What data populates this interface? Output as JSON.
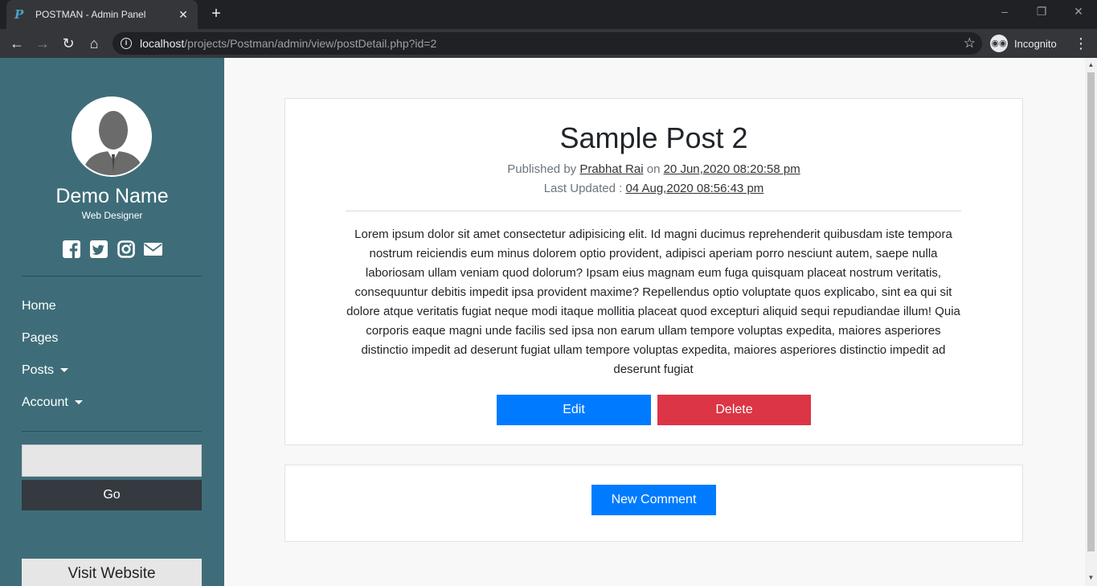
{
  "browser": {
    "tab_title": "POSTMAN - Admin Panel",
    "url_host": "localhost",
    "url_path": "/projects/Postman/admin/view/postDetail.php?id=2",
    "profile_label": "Incognito"
  },
  "sidebar": {
    "name": "Demo Name",
    "role": "Web Designer",
    "social_icons": [
      "facebook-icon",
      "twitter-icon",
      "instagram-icon",
      "envelope-icon"
    ],
    "menu": [
      {
        "label": "Home"
      },
      {
        "label": "Pages"
      },
      {
        "label": "Posts"
      },
      {
        "label": "Account"
      }
    ],
    "search_value": "",
    "go_label": "Go",
    "visit_label": "Visit Website"
  },
  "post": {
    "title": "Sample Post 2",
    "published_prefix": "Published by",
    "author": "Prabhat Rai",
    "on_word": "on",
    "published_date": "20 Jun,2020 08:20:58 pm",
    "updated_prefix": "Last Updated :",
    "updated_date": "04 Aug,2020 08:56:43 pm",
    "body": "Lorem ipsum dolor sit amet consectetur adipisicing elit. Id magni ducimus reprehenderit quibusdam iste tempora nostrum reiciendis eum minus dolorem optio provident, adipisci aperiam porro nesciunt autem, saepe nulla laboriosam ullam veniam quod dolorum? Ipsam eius magnam eum fuga quisquam placeat nostrum veritatis, consequuntur debitis impedit ipsa provident maxime? Repellendus optio voluptate quos explicabo, sint ea qui sit dolore atque veritatis fugiat neque modi itaque mollitia placeat quod excepturi aliquid sequi repudiandae illum! Quia corporis eaque magni unde facilis sed ipsa non earum ullam tempore voluptas expedita, maiores asperiores distinctio impedit ad deserunt fugiat ullam tempore voluptas expedita, maiores asperiores distinctio impedit ad deserunt fugiat",
    "edit_label": "Edit",
    "delete_label": "Delete"
  },
  "comments": {
    "new_label": "New Comment"
  },
  "colors": {
    "sidebar_bg": "#3e6d79",
    "primary": "#007bff",
    "danger": "#dc3545",
    "dark": "#343a40"
  }
}
